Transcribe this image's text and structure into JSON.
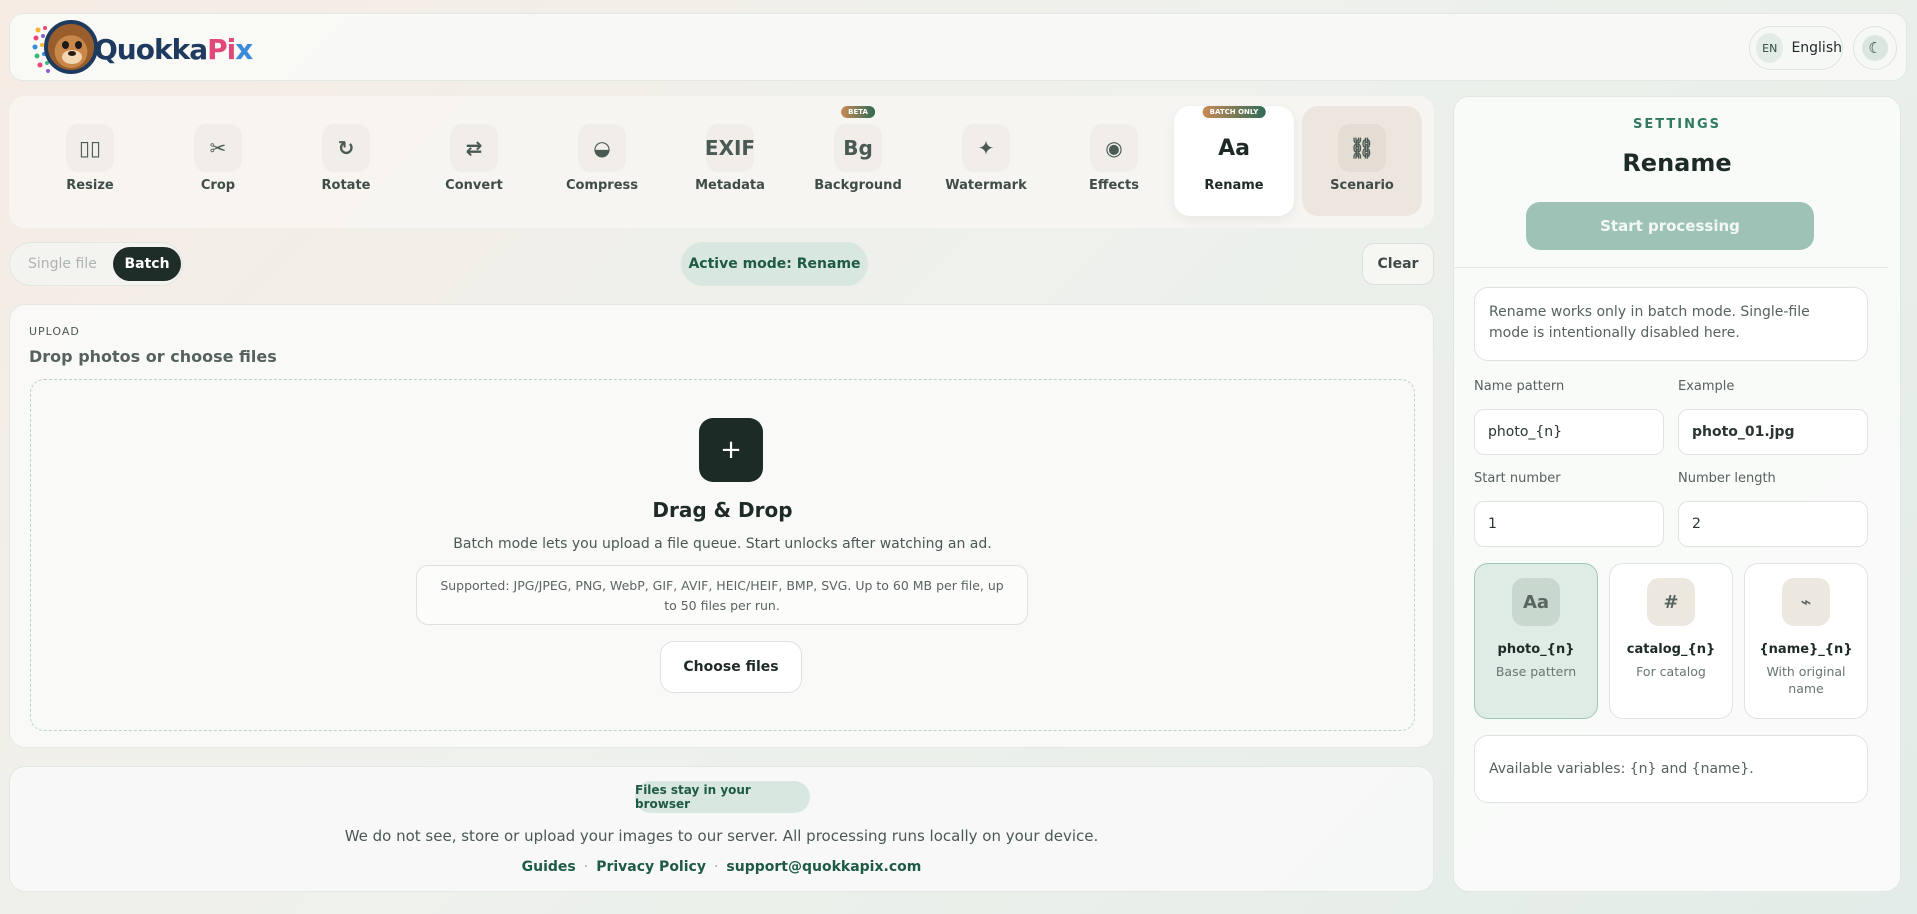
{
  "header": {
    "logo_text_a": "Quokka",
    "logo_text_b": "Pi",
    "logo_text_c": "x",
    "lang_code": "EN",
    "lang_label": "English",
    "theme_icon": "moon-icon"
  },
  "tools": [
    {
      "label": "Resize",
      "icon": "▯▯",
      "badge": ""
    },
    {
      "label": "Crop",
      "icon": "✂",
      "badge": ""
    },
    {
      "label": "Rotate",
      "icon": "↻",
      "badge": ""
    },
    {
      "label": "Convert",
      "icon": "⇄",
      "badge": ""
    },
    {
      "label": "Compress",
      "icon": "◒",
      "badge": ""
    },
    {
      "label": "Metadata",
      "icon": "EXIF",
      "badge": ""
    },
    {
      "label": "Background",
      "icon": "Bg",
      "badge": "BETA"
    },
    {
      "label": "Watermark",
      "icon": "✦",
      "badge": ""
    },
    {
      "label": "Effects",
      "icon": "◉",
      "badge": ""
    },
    {
      "label": "Rename",
      "icon": "Aa",
      "badge": "BATCH ONLY"
    },
    {
      "label": "Scenario",
      "icon": "⛓",
      "badge": ""
    }
  ],
  "mode": {
    "single": "Single file",
    "batch": "Batch",
    "active": "Active mode: Rename",
    "clear": "Clear"
  },
  "upload": {
    "tag": "UPLOAD",
    "title": "Drop photos or choose files",
    "plus": "+",
    "dd_title": "Drag & Drop",
    "dd_sub": "Batch mode lets you upload a file queue. Start unlocks after watching an ad.",
    "supported": "Supported: JPG/JPEG, PNG, WebP, GIF, AVIF, HEIC/HEIF, BMP, SVG. Up to 60 MB per file, up to 50 files per run.",
    "choose": "Choose files"
  },
  "footer": {
    "pill": "Files stay in your browser",
    "text": "We do not see, store or upload your images to our server. All processing runs locally on your device.",
    "link_guides": "Guides",
    "link_privacy": "Privacy Policy",
    "link_email": "support@quokkapix.com",
    "sep": "·"
  },
  "settings": {
    "tag": "SETTINGS",
    "title": "Rename",
    "start": "Start processing",
    "note": "Rename works only in batch mode. Single-file mode is intentionally disabled here.",
    "name_pattern_label": "Name pattern",
    "name_pattern_value": "photo_{n}",
    "example_label": "Example",
    "example_value": "photo_01.jpg",
    "start_number_label": "Start number",
    "start_number_value": "1",
    "number_length_label": "Number length",
    "number_length_value": "2",
    "presets": [
      {
        "icon": "Aa",
        "name": "photo_{n}",
        "desc": "Base pattern"
      },
      {
        "icon": "#",
        "name": "catalog_{n}",
        "desc": "For catalog"
      },
      {
        "icon": "⌁",
        "name": "{name}_{n}",
        "desc": "With original name"
      }
    ],
    "vars": "Available variables: {n} and {name}."
  },
  "colors": {
    "accent": "#1e5a44",
    "dark_button": "#1c2b26",
    "start_disabled": "#9ec3b6"
  }
}
